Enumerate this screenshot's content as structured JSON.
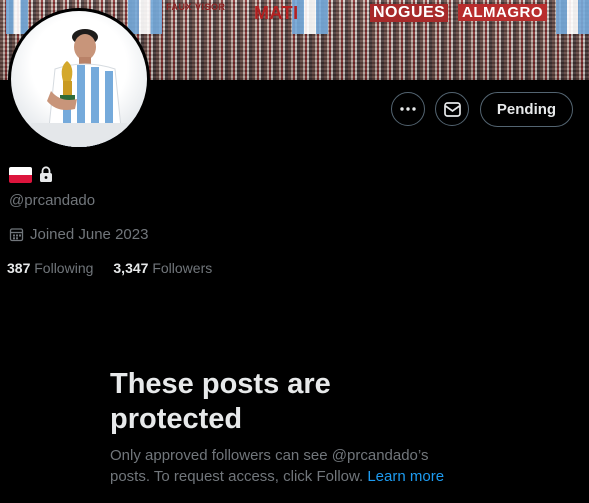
{
  "banner": {
    "signs": [
      "FAUX VISOR",
      "MATI",
      "NOGUES",
      "ALMAGRO"
    ]
  },
  "actions": {
    "more_icon": "more-icon",
    "message_icon": "message-icon",
    "pending_label": "Pending"
  },
  "profile": {
    "handle": "@prcandado",
    "joined": "Joined June 2023",
    "following_count": "387",
    "following_label": "Following",
    "followers_count": "3,347",
    "followers_label": "Followers"
  },
  "protected": {
    "title": "These posts are protected",
    "desc": "Only approved followers can see @prcandado’s posts. To request access, click Follow.",
    "learn_more": "Learn more"
  },
  "colors": {
    "background": "#000000",
    "text": "#e7e9ea",
    "muted": "#71767b",
    "link": "#1d9bf0",
    "border": "#536471"
  }
}
